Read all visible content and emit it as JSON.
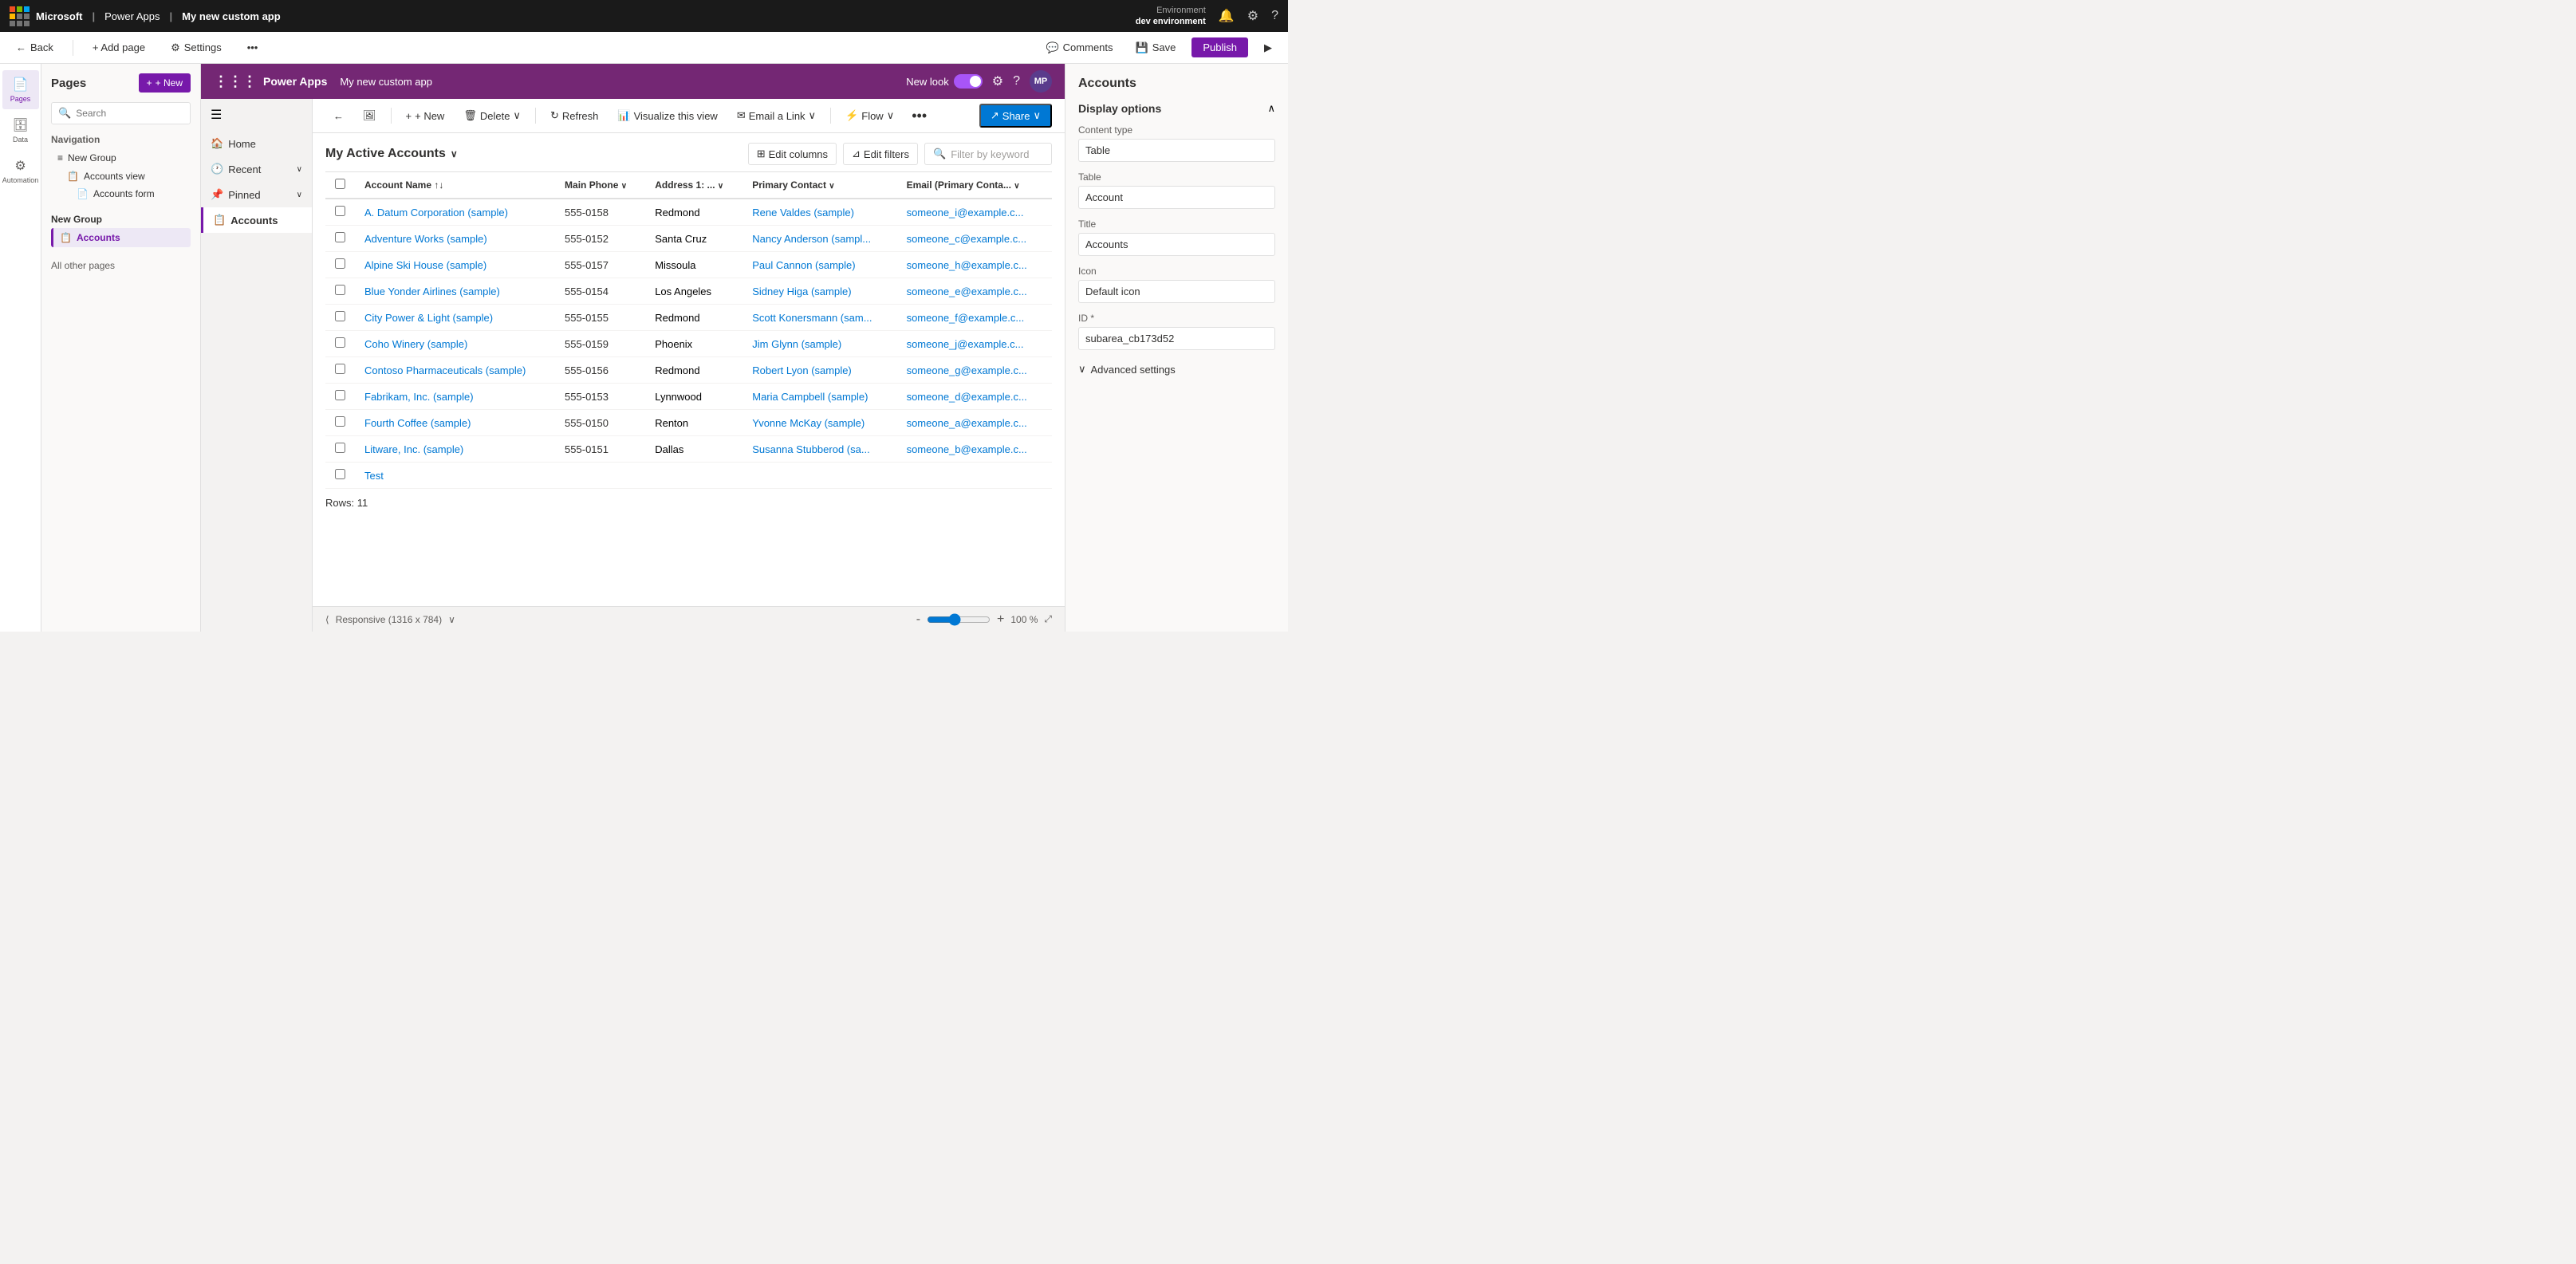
{
  "topbar": {
    "company": "Microsoft",
    "product": "Power Apps",
    "separator": "|",
    "app_name": "My new custom app",
    "environment_label": "Environment",
    "environment_name": "dev environment",
    "back_label": "Back",
    "add_page_label": "+ Add page",
    "settings_label": "Settings",
    "comments_label": "Comments",
    "save_label": "Save",
    "publish_label": "Publish"
  },
  "left_sidebar": {
    "items": [
      {
        "id": "pages",
        "icon": "📄",
        "label": "Pages",
        "active": true
      },
      {
        "id": "data",
        "icon": "🗄️",
        "label": "Data",
        "active": false
      },
      {
        "id": "automation",
        "icon": "⚙️",
        "label": "Automation",
        "active": false
      }
    ]
  },
  "pages_panel": {
    "title": "Pages",
    "new_button": "+ New",
    "search_placeholder": "Search",
    "navigation_title": "Navigation",
    "nav_items": [
      {
        "id": "new-group",
        "label": "New Group",
        "type": "group",
        "expandable": false
      },
      {
        "id": "accounts-view",
        "label": "Accounts view",
        "type": "sub",
        "icon": "📋"
      },
      {
        "id": "accounts-form",
        "label": "Accounts form",
        "type": "sub2",
        "icon": "📄"
      }
    ],
    "new_group_label": "New Group",
    "all_other_pages_label": "All other pages"
  },
  "powerapp_header": {
    "logo_text": "Power Apps",
    "app_name": "My new custom app",
    "new_look_label": "New look",
    "settings_icon": "⚙️",
    "help_icon": "?",
    "avatar_text": "MP"
  },
  "inner_sidebar": {
    "items": [
      {
        "id": "home",
        "icon": "🏠",
        "label": "Home"
      },
      {
        "id": "recent",
        "icon": "🕐",
        "label": "Recent",
        "expandable": true
      },
      {
        "id": "pinned",
        "icon": "📌",
        "label": "Pinned",
        "expandable": true
      },
      {
        "id": "accounts",
        "icon": "📋",
        "label": "Accounts",
        "active": true
      }
    ]
  },
  "view_toolbar": {
    "back_icon": "←",
    "image_icon": "🖼️",
    "new_label": "+ New",
    "delete_label": "🗑 Delete",
    "refresh_label": "↻ Refresh",
    "visualize_label": "📊 Visualize this view",
    "email_label": "✉ Email a Link",
    "flow_label": "⚡ Flow",
    "more_icon": "•••",
    "share_label": "Share"
  },
  "grid": {
    "title": "My Active Accounts",
    "edit_columns_label": "Edit columns",
    "edit_filters_label": "Edit filters",
    "filter_placeholder": "Filter by keyword",
    "columns": [
      {
        "id": "account_name",
        "label": "Account Name ↑↓"
      },
      {
        "id": "main_phone",
        "label": "Main Phone"
      },
      {
        "id": "address",
        "label": "Address 1: ..."
      },
      {
        "id": "primary_contact",
        "label": "Primary Contact"
      },
      {
        "id": "email",
        "label": "Email (Primary Conta..."
      }
    ],
    "rows": [
      {
        "account_name": "A. Datum Corporation (sample)",
        "phone": "555-0158",
        "address": "Redmond",
        "contact": "Rene Valdes (sample)",
        "email": "someone_i@example.c..."
      },
      {
        "account_name": "Adventure Works (sample)",
        "phone": "555-0152",
        "address": "Santa Cruz",
        "contact": "Nancy Anderson (sampl...",
        "email": "someone_c@example.c..."
      },
      {
        "account_name": "Alpine Ski House (sample)",
        "phone": "555-0157",
        "address": "Missoula",
        "contact": "Paul Cannon (sample)",
        "email": "someone_h@example.c..."
      },
      {
        "account_name": "Blue Yonder Airlines (sample)",
        "phone": "555-0154",
        "address": "Los Angeles",
        "contact": "Sidney Higa (sample)",
        "email": "someone_e@example.c..."
      },
      {
        "account_name": "City Power & Light (sample)",
        "phone": "555-0155",
        "address": "Redmond",
        "contact": "Scott Konersmann (sam...",
        "email": "someone_f@example.c..."
      },
      {
        "account_name": "Coho Winery (sample)",
        "phone": "555-0159",
        "address": "Phoenix",
        "contact": "Jim Glynn (sample)",
        "email": "someone_j@example.c..."
      },
      {
        "account_name": "Contoso Pharmaceuticals (sample)",
        "phone": "555-0156",
        "address": "Redmond",
        "contact": "Robert Lyon (sample)",
        "email": "someone_g@example.c..."
      },
      {
        "account_name": "Fabrikam, Inc. (sample)",
        "phone": "555-0153",
        "address": "Lynnwood",
        "contact": "Maria Campbell (sample)",
        "email": "someone_d@example.c..."
      },
      {
        "account_name": "Fourth Coffee (sample)",
        "phone": "555-0150",
        "address": "Renton",
        "contact": "Yvonne McKay (sample)",
        "email": "someone_a@example.c..."
      },
      {
        "account_name": "Litware, Inc. (sample)",
        "phone": "555-0151",
        "address": "Dallas",
        "contact": "Susanna Stubberod (sa...",
        "email": "someone_b@example.c..."
      },
      {
        "account_name": "Test",
        "phone": "",
        "address": "",
        "contact": "",
        "email": ""
      }
    ],
    "rows_count_label": "Rows:",
    "rows_count": "11"
  },
  "right_panel": {
    "title": "Accounts",
    "display_options_label": "Display options",
    "display_options_expanded": true,
    "content_type_label": "Content type",
    "content_type_value": "Table",
    "table_label": "Table",
    "table_value": "Account",
    "title_label": "Title",
    "title_value": "Accounts",
    "icon_label": "Icon",
    "icon_value": "Default icon",
    "id_label": "ID *",
    "id_value": "subarea_cb173d52",
    "advanced_settings_label": "Advanced settings"
  },
  "bottom_bar": {
    "responsive_label": "Responsive (1316 x 784)",
    "zoom_minus": "-",
    "zoom_value": "100 %",
    "zoom_plus": "+"
  },
  "colors": {
    "purple": "#742774",
    "purple_light": "#7719aa",
    "blue": "#0078d4"
  }
}
